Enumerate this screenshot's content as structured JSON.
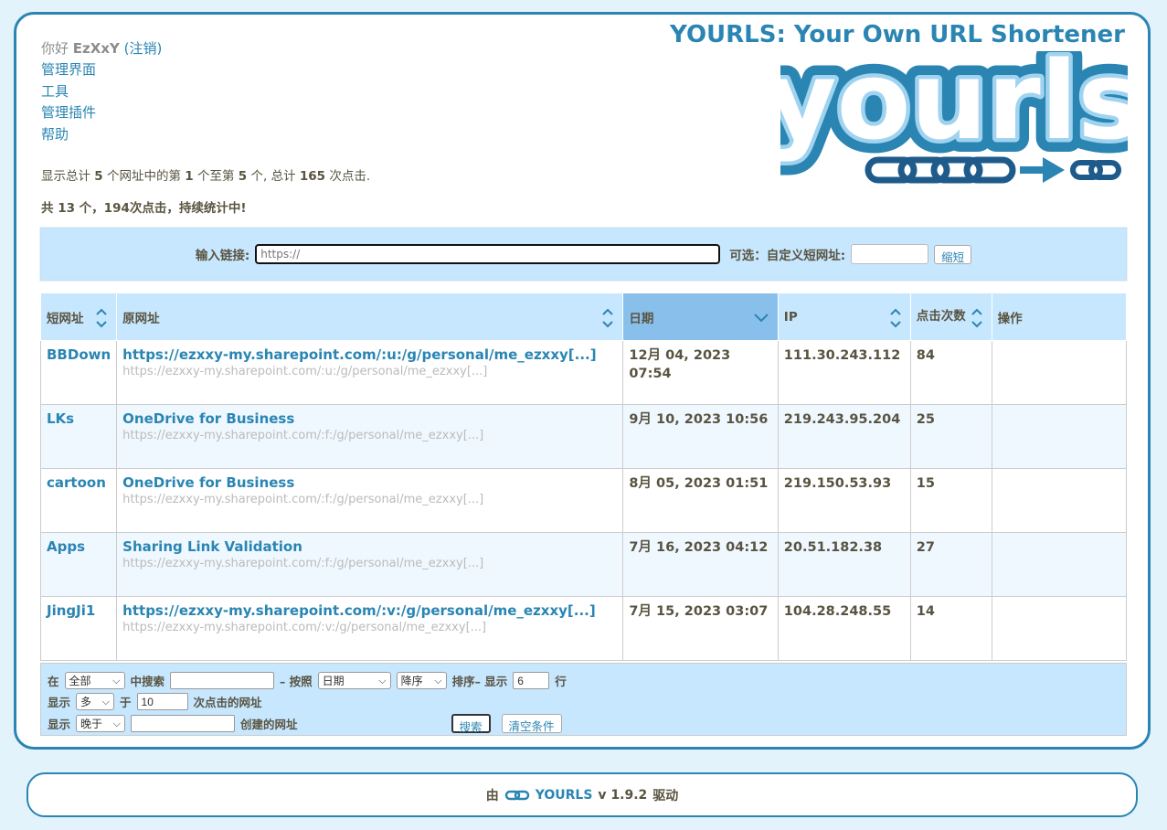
{
  "header": {
    "greeting": "你好",
    "username": "EzXxY",
    "logout_label": "(注销)",
    "brand_title": "YOURLS: Your Own URL Shortener",
    "logo_text": "yourls"
  },
  "nav": {
    "items": [
      {
        "label": "管理界面"
      },
      {
        "label": "工具"
      },
      {
        "label": "管理插件"
      },
      {
        "label": "帮助"
      }
    ]
  },
  "stats": {
    "part1": "显示总计 ",
    "total_urls": "5",
    "part2": " 个网址中的第 ",
    "from": "1",
    "part3": " 个至第 ",
    "to": "5",
    "part4": " 个, 总计 ",
    "clicks": "165",
    "part5": " 次点击.",
    "overall": "共 13 个，194次点击，持续统计中!"
  },
  "new_url": {
    "label": "输入链接:",
    "placeholder": "https://",
    "keyword_label": "可选：自定义短网址:",
    "submit_label": "缩短"
  },
  "table": {
    "headers": {
      "keyword": "短网址",
      "url": "原网址",
      "date": "日期",
      "ip": "IP",
      "clicks": "点击次数",
      "actions": "操作"
    },
    "rows": [
      {
        "keyword": "BBDown",
        "title": "https://ezxxy-my.sharepoint.com/:u:/g/personal/me_ezxxy[...]",
        "url": "https://ezxxy-my.sharepoint.com/:u:/g/personal/me_ezxxy[...]",
        "date": "12月 04, 2023 07:54",
        "ip": "111.30.243.112",
        "clicks": "84"
      },
      {
        "keyword": "LKs",
        "title": "OneDrive for Business",
        "url": "https://ezxxy-my.sharepoint.com/:f:/g/personal/me_ezxxy[...]",
        "date": "9月 10, 2023 10:56",
        "ip": "219.243.95.204",
        "clicks": "25"
      },
      {
        "keyword": "cartoon",
        "title": "OneDrive for Business",
        "url": "https://ezxxy-my.sharepoint.com/:f:/g/personal/me_ezxxy[...]",
        "date": "8月 05, 2023 01:51",
        "ip": "219.150.53.93",
        "clicks": "15"
      },
      {
        "keyword": "Apps",
        "title": "Sharing Link Validation",
        "url": "https://ezxxy-my.sharepoint.com/:f:/g/personal/me_ezxxy[...]",
        "date": "7月 16, 2023 04:12",
        "ip": "20.51.182.38",
        "clicks": "27"
      },
      {
        "keyword": "JingJi1",
        "title": "https://ezxxy-my.sharepoint.com/:v:/g/personal/me_ezxxy[...]",
        "url": "https://ezxxy-my.sharepoint.com/:v:/g/personal/me_ezxxy[...]",
        "date": "7月 15, 2023 03:07",
        "ip": "104.28.248.55",
        "clicks": "14"
      }
    ]
  },
  "filter": {
    "in_label": "在",
    "search_in": "全部",
    "search_label": "中搜索",
    "order_by_label": "– 按照",
    "sort_by": "日期",
    "sort_order": "降序",
    "sort_label": "排序– 显示",
    "per_page": "6",
    "rows_label": "行",
    "show_label": "显示",
    "click_filter": "多",
    "than_label": "于",
    "click_limit": "10",
    "clicks_urls_label": "次点击的网址",
    "show_label2": "显示",
    "date_filter": "晚于",
    "date_value": "",
    "created_label": "创建的网址",
    "search_button": "搜索",
    "clear_button": "清空条件"
  },
  "footer": {
    "prefix": "由",
    "link": "YOURLS",
    "version": "v 1.9.2",
    "suffix": "驱动"
  },
  "colors": {
    "accent": "#2a85b3",
    "background": "#e3f3fc",
    "header_bg": "#c7e7ff",
    "active_header_bg": "#88c0eb"
  }
}
